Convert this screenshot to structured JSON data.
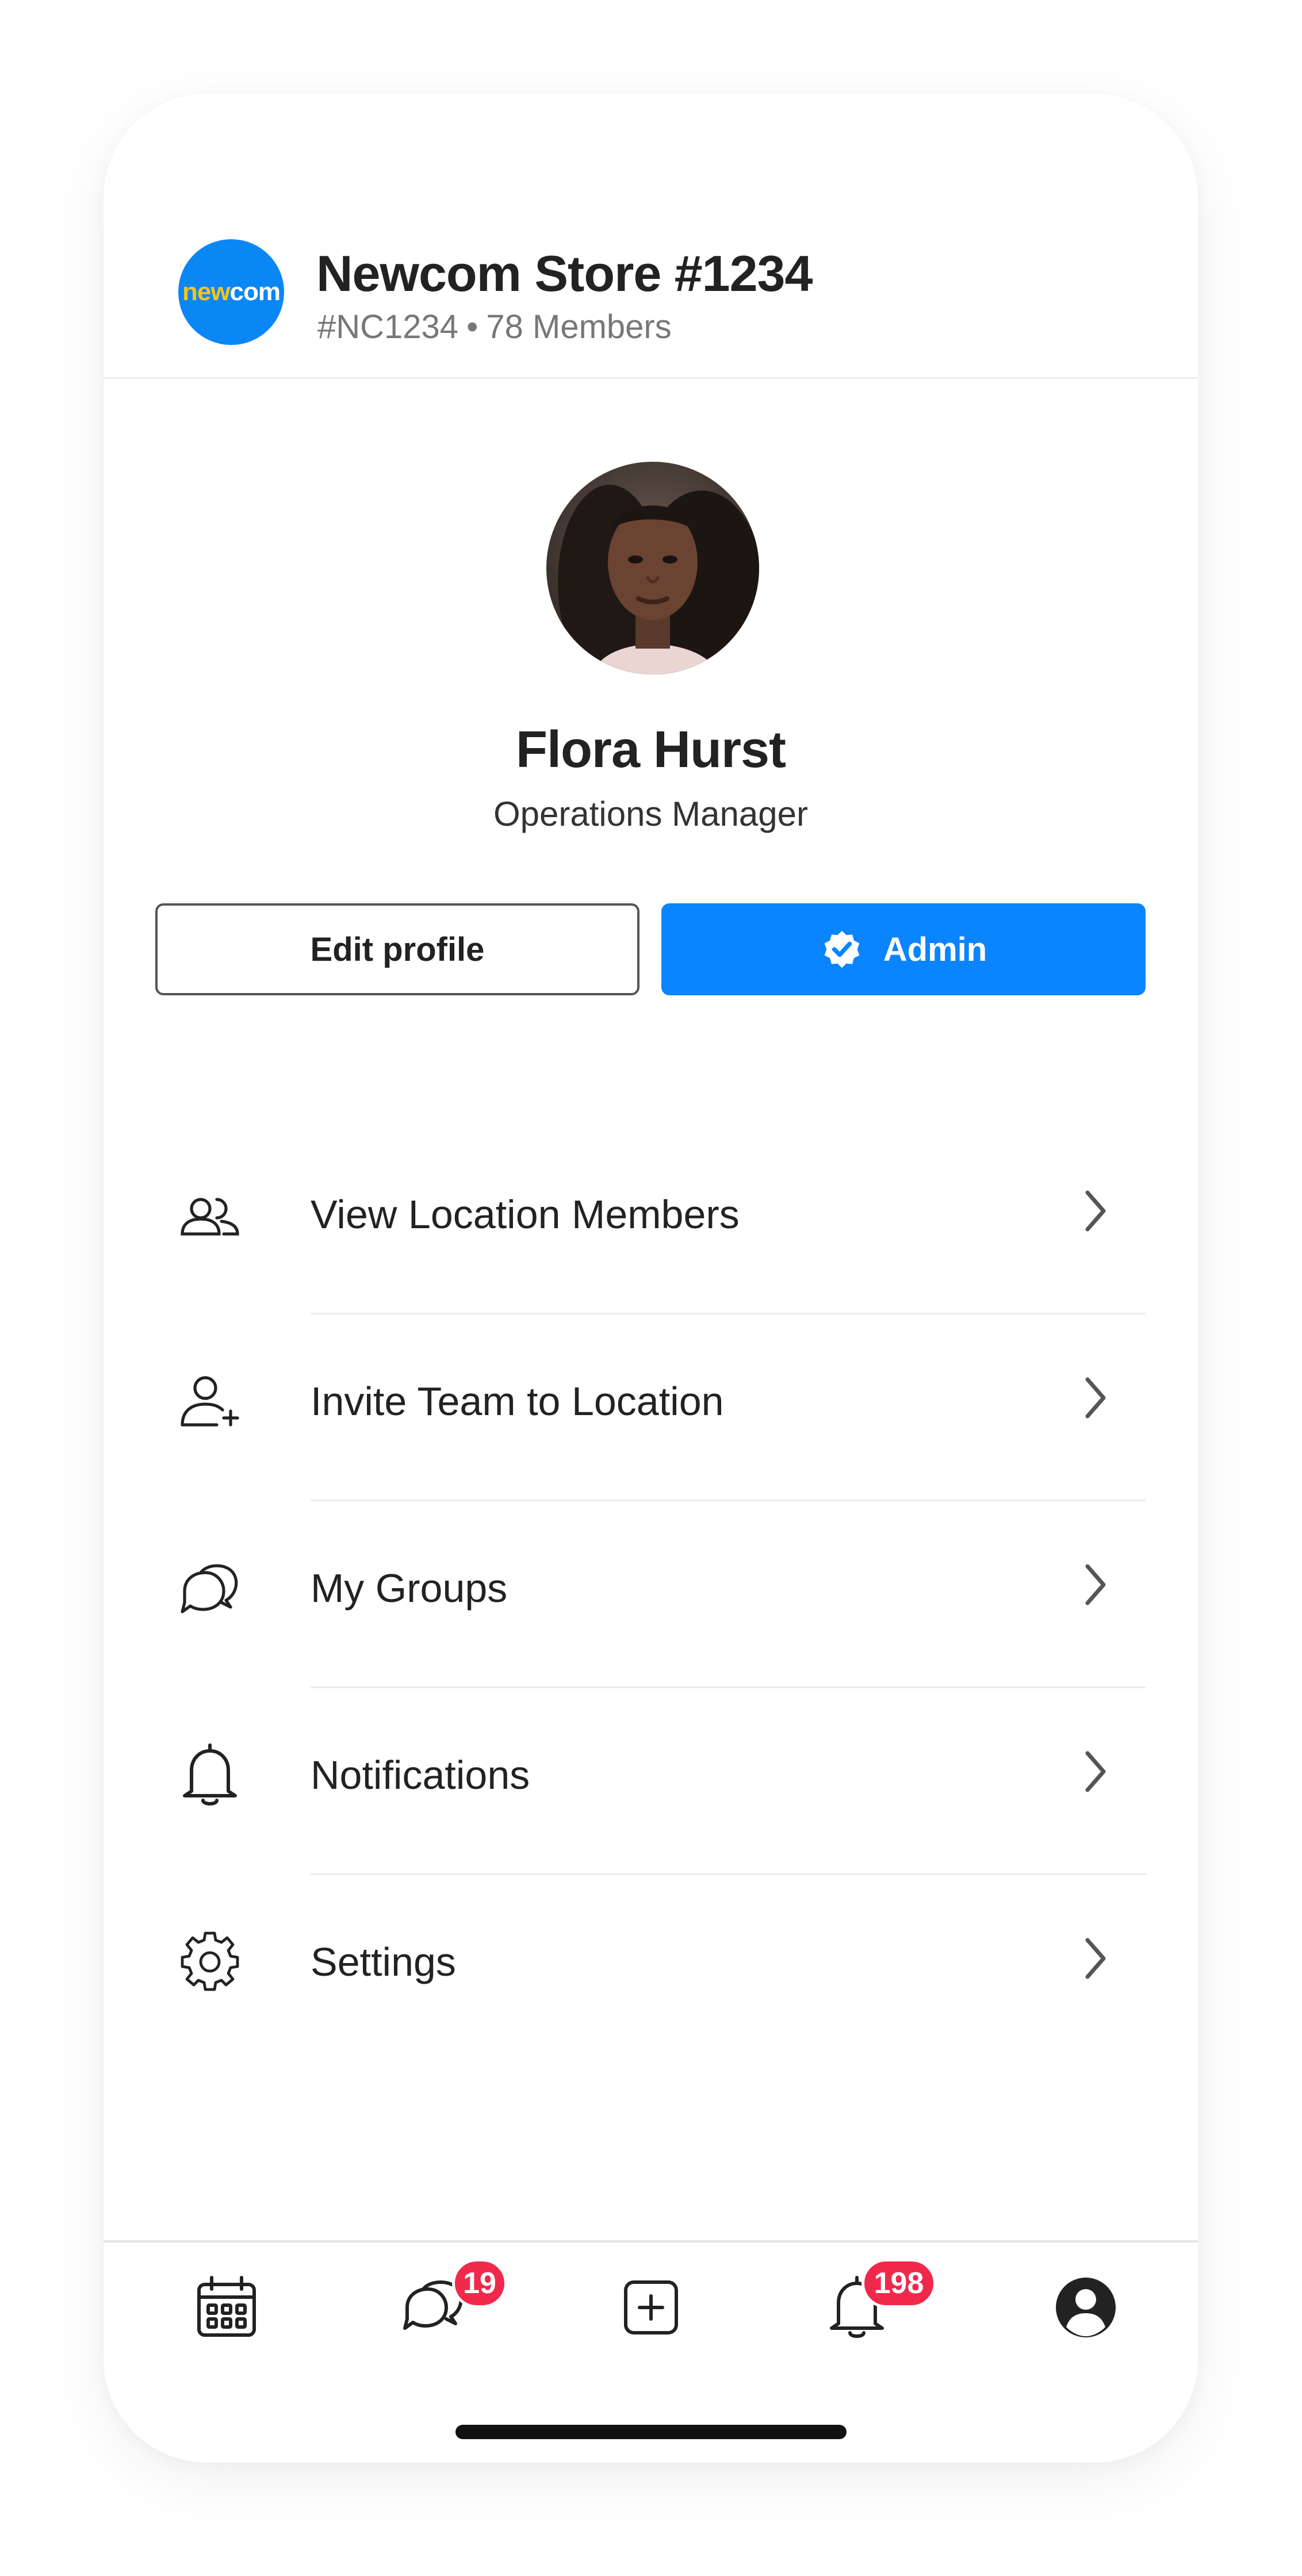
{
  "store": {
    "logo_part1": "new",
    "logo_part2": "com",
    "name": "Newcom Store #1234",
    "code": "#NC1234",
    "separator": "•",
    "members": "78 Members"
  },
  "profile": {
    "name": "Flora Hurst",
    "role": "Operations Manager",
    "edit_label": "Edit profile",
    "admin_label": "Admin"
  },
  "menu": [
    {
      "label": "View Location Members",
      "icon": "users-icon"
    },
    {
      "label": "Invite Team to Location",
      "icon": "user-plus-icon"
    },
    {
      "label": "My Groups",
      "icon": "chat-bubbles-icon"
    },
    {
      "label": "Notifications",
      "icon": "bell-icon"
    },
    {
      "label": "Settings",
      "icon": "gear-icon"
    }
  ],
  "tabbar": {
    "messages_badge": "19",
    "notifications_badge": "198"
  },
  "colors": {
    "accent": "#0a84ff",
    "badge": "#f0294a",
    "logo_blue": "#0b87f5",
    "logo_yellow": "#f6c31c"
  }
}
